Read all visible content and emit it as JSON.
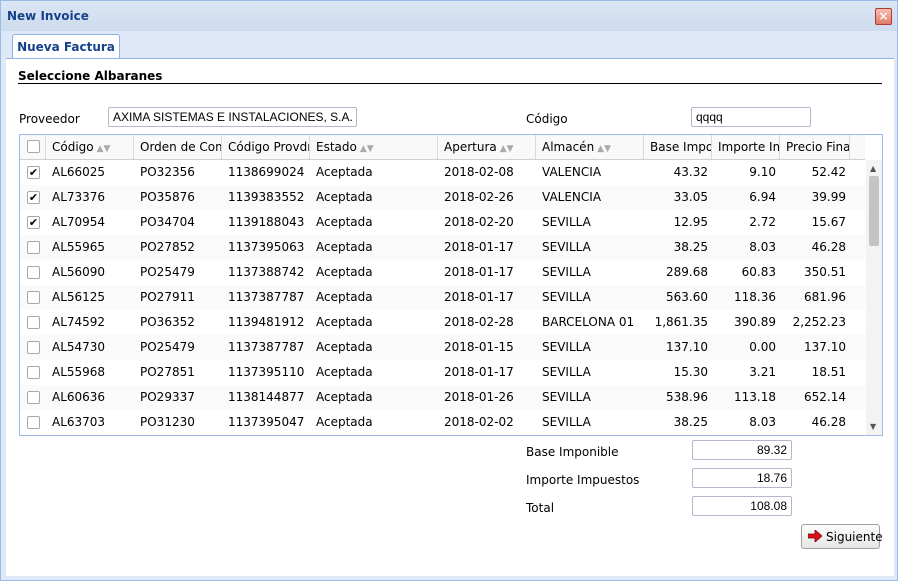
{
  "window": {
    "title": "New Invoice"
  },
  "tabs": [
    {
      "label": "Nueva Factura"
    }
  ],
  "section": {
    "title": "Seleccione Albaranes"
  },
  "form": {
    "proveedor_label": "Proveedor",
    "proveedor_value": "AXIMA SISTEMAS E INSTALACIONES, S.A.",
    "codigo_label": "Código",
    "codigo_value": "qqqq"
  },
  "grid": {
    "columns": [
      "Código",
      "Orden de Comp",
      "Código Provdr.",
      "Estado",
      "Apertura",
      "Almacén",
      "Base Impon",
      "Importe Imp",
      "Precio Final"
    ],
    "rows": [
      {
        "checked": true,
        "codigo": "AL66025",
        "orden": "PO32356",
        "provdr": "1138699024",
        "estado": "Aceptada",
        "apertura": "2018-02-08",
        "almacen": "VALENCIA",
        "base": "43.32",
        "importe": "9.10",
        "precio": "52.42"
      },
      {
        "checked": true,
        "codigo": "AL73376",
        "orden": "PO35876",
        "provdr": "1139383552",
        "estado": "Aceptada",
        "apertura": "2018-02-26",
        "almacen": "VALENCIA",
        "base": "33.05",
        "importe": "6.94",
        "precio": "39.99"
      },
      {
        "checked": true,
        "codigo": "AL70954",
        "orden": "PO34704",
        "provdr": "1139188043",
        "estado": "Aceptada",
        "apertura": "2018-02-20",
        "almacen": "SEVILLA",
        "base": "12.95",
        "importe": "2.72",
        "precio": "15.67"
      },
      {
        "checked": false,
        "codigo": "AL55965",
        "orden": "PO27852",
        "provdr": "1137395063",
        "estado": "Aceptada",
        "apertura": "2018-01-17",
        "almacen": "SEVILLA",
        "base": "38.25",
        "importe": "8.03",
        "precio": "46.28"
      },
      {
        "checked": false,
        "codigo": "AL56090",
        "orden": "PO25479",
        "provdr": "1137388742",
        "estado": "Aceptada",
        "apertura": "2018-01-17",
        "almacen": "SEVILLA",
        "base": "289.68",
        "importe": "60.83",
        "precio": "350.51"
      },
      {
        "checked": false,
        "codigo": "AL56125",
        "orden": "PO27911",
        "provdr": "1137387787",
        "estado": "Aceptada",
        "apertura": "2018-01-17",
        "almacen": "SEVILLA",
        "base": "563.60",
        "importe": "118.36",
        "precio": "681.96"
      },
      {
        "checked": false,
        "codigo": "AL74592",
        "orden": "PO36352",
        "provdr": "1139481912",
        "estado": "Aceptada",
        "apertura": "2018-02-28",
        "almacen": "BARCELONA 01",
        "base": "1,861.35",
        "importe": "390.89",
        "precio": "2,252.23"
      },
      {
        "checked": false,
        "codigo": "AL54730",
        "orden": "PO25479",
        "provdr": "1137387787",
        "estado": "Aceptada",
        "apertura": "2018-01-15",
        "almacen": "SEVILLA",
        "base": "137.10",
        "importe": "0.00",
        "precio": "137.10"
      },
      {
        "checked": false,
        "codigo": "AL55968",
        "orden": "PO27851",
        "provdr": "1137395110",
        "estado": "Aceptada",
        "apertura": "2018-01-17",
        "almacen": "SEVILLA",
        "base": "15.30",
        "importe": "3.21",
        "precio": "18.51"
      },
      {
        "checked": false,
        "codigo": "AL60636",
        "orden": "PO29337",
        "provdr": "1138144877",
        "estado": "Aceptada",
        "apertura": "2018-01-26",
        "almacen": "SEVILLA",
        "base": "538.96",
        "importe": "113.18",
        "precio": "652.14"
      },
      {
        "checked": false,
        "codigo": "AL63703",
        "orden": "PO31230",
        "provdr": "1137395047",
        "estado": "Aceptada",
        "apertura": "2018-02-02",
        "almacen": "SEVILLA",
        "base": "38.25",
        "importe": "8.03",
        "precio": "46.28"
      }
    ]
  },
  "totals": {
    "base_label": "Base Imponible",
    "base_value": "89.32",
    "impuestos_label": "Importe Impuestos",
    "impuestos_value": "18.76",
    "total_label": "Total",
    "total_value": "108.08"
  },
  "buttons": {
    "next_label": "Siguiente"
  },
  "icons": {
    "close": "close-icon",
    "next": "red-arrow-right-icon",
    "sort": "sort-icon"
  },
  "colors": {
    "title_text": "#15428b",
    "border": "#99bbe8",
    "close_button": "#e27a6a",
    "arrow": "#d8141a"
  }
}
